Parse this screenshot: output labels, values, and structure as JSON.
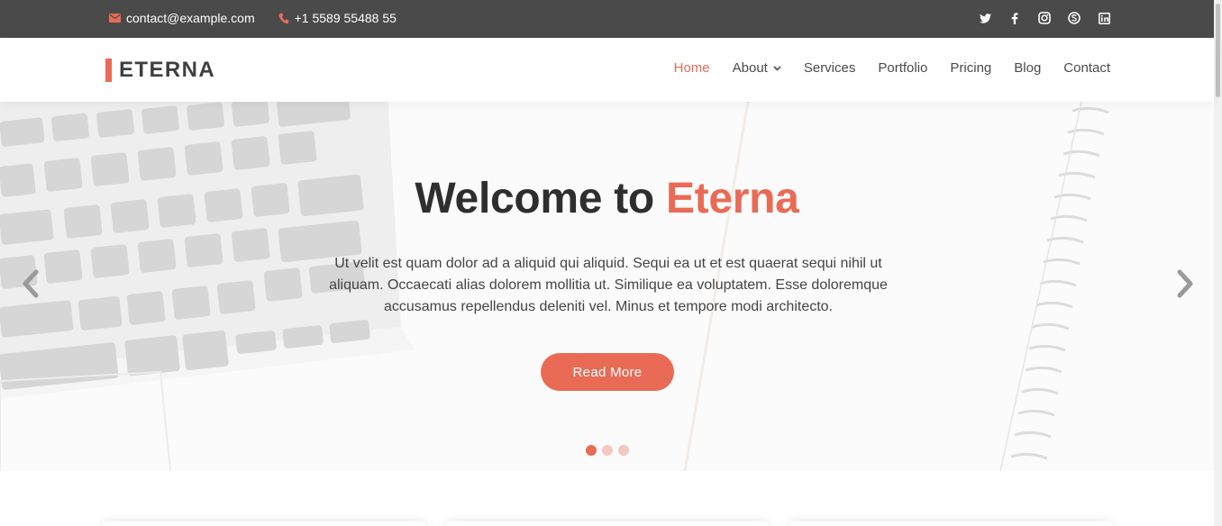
{
  "topbar": {
    "email": "contact@example.com",
    "phone": "+1 5589 55488 55",
    "social": [
      "twitter-icon",
      "facebook-icon",
      "instagram-icon",
      "skype-icon",
      "linkedin-icon"
    ]
  },
  "header": {
    "logo": "ETERNA",
    "nav": [
      {
        "label": "Home",
        "active": true
      },
      {
        "label": "About",
        "dropdown": true
      },
      {
        "label": "Services"
      },
      {
        "label": "Portfolio"
      },
      {
        "label": "Pricing"
      },
      {
        "label": "Blog"
      },
      {
        "label": "Contact"
      }
    ]
  },
  "hero": {
    "title_prefix": "Welcome to ",
    "title_accent": "Eterna",
    "description": "Ut velit est quam dolor ad a aliquid qui aliquid. Sequi ea ut et est quaerat sequi nihil ut aliquam. Occaecati alias dolorem mollitia ut. Similique ea voluptatem. Esse doloremque accusamus repellendus deleniti vel. Minus et tempore modi architecto.",
    "button": "Read More",
    "slides": 3,
    "active_slide": 1
  },
  "colors": {
    "accent": "#e96b56",
    "topbar_bg": "#4a4a4a",
    "text_dark": "#2e2e2e"
  }
}
